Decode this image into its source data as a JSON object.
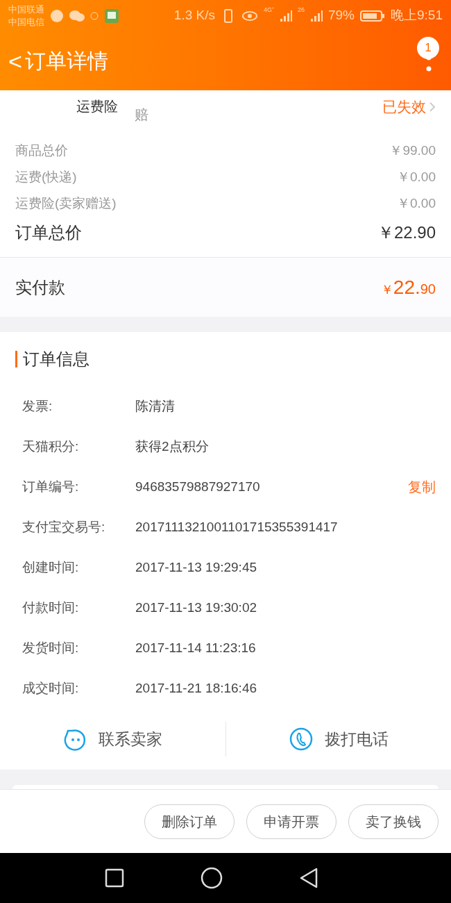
{
  "status_bar": {
    "carriers": [
      "中国联通",
      "中国电信"
    ],
    "speed": "1.3 K/s",
    "network_1": "4G⁺",
    "network_2": "26",
    "battery": "79%",
    "time": "晚上9:51"
  },
  "header": {
    "back": "<",
    "title": "订单详情",
    "badge": "1"
  },
  "insurance_row": {
    "label": "运费险",
    "note": "赔",
    "status": "已失效"
  },
  "price_rows": [
    {
      "label": "商品总价",
      "value": "￥99.00"
    },
    {
      "label": "运费(快递)",
      "value": "￥0.00"
    },
    {
      "label": "运费险(卖家赠送)",
      "value": "￥0.00"
    }
  ],
  "order_total": {
    "label": "订单总价",
    "value": "￥22.90"
  },
  "paid": {
    "label": "实付款",
    "currency": "￥",
    "integer": "22.",
    "decimal": "90"
  },
  "order_info": {
    "title": "订单信息",
    "rows": [
      {
        "label": "发票:",
        "value": "陈清清"
      },
      {
        "label": "天猫积分:",
        "value": "获得2点积分"
      },
      {
        "label": "订单编号:",
        "value": "94683579887927170",
        "action": "复制"
      },
      {
        "label": "支付宝交易号:",
        "value": "2017111321001101715355391417"
      },
      {
        "label": "创建时间:",
        "value": "2017-11-13 19:29:45"
      },
      {
        "label": "付款时间:",
        "value": "2017-11-13 19:30:02"
      },
      {
        "label": "发货时间:",
        "value": "2017-11-14 11:23:16"
      },
      {
        "label": "成交时间:",
        "value": "2017-11-21 18:16:46"
      }
    ]
  },
  "contact_actions": [
    {
      "kind": "chat",
      "label": "联系卖家"
    },
    {
      "kind": "phone",
      "label": "拨打电话"
    }
  ],
  "bottom_buttons": [
    "删除订单",
    "申请开票",
    "卖了换钱"
  ]
}
